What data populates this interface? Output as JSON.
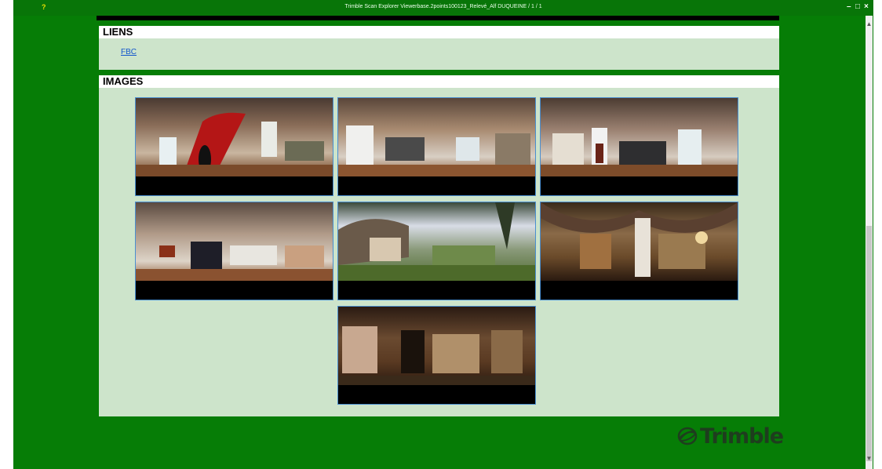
{
  "window": {
    "title": "Trimble Scan Explorer Viewerbase.2points100123_Relevé_Alf DUQUEINE / 1 / 1",
    "help_label": "?",
    "controls": [
      "–",
      "□",
      "×"
    ]
  },
  "sections": {
    "links": {
      "heading": "LIENS",
      "items": [
        {
          "label": "FBC"
        }
      ]
    },
    "images": {
      "heading": "IMAGES",
      "thumbnails": [
        {
          "icon": "panorama-staircase-interior"
        },
        {
          "icon": "panorama-living-room"
        },
        {
          "icon": "panorama-living-dining"
        },
        {
          "icon": "panorama-lounge"
        },
        {
          "icon": "panorama-garden-exterior"
        },
        {
          "icon": "panorama-cellar-workshop"
        },
        {
          "icon": "panorama-basement-storage"
        }
      ]
    }
  },
  "brand": {
    "logo_text": "Trimble",
    "logo_color": "#1e3d1e"
  },
  "colors": {
    "background": "#067d06",
    "panel": "#cde4cb",
    "thumb_border": "#4a8fd0",
    "link": "#1155cc"
  }
}
